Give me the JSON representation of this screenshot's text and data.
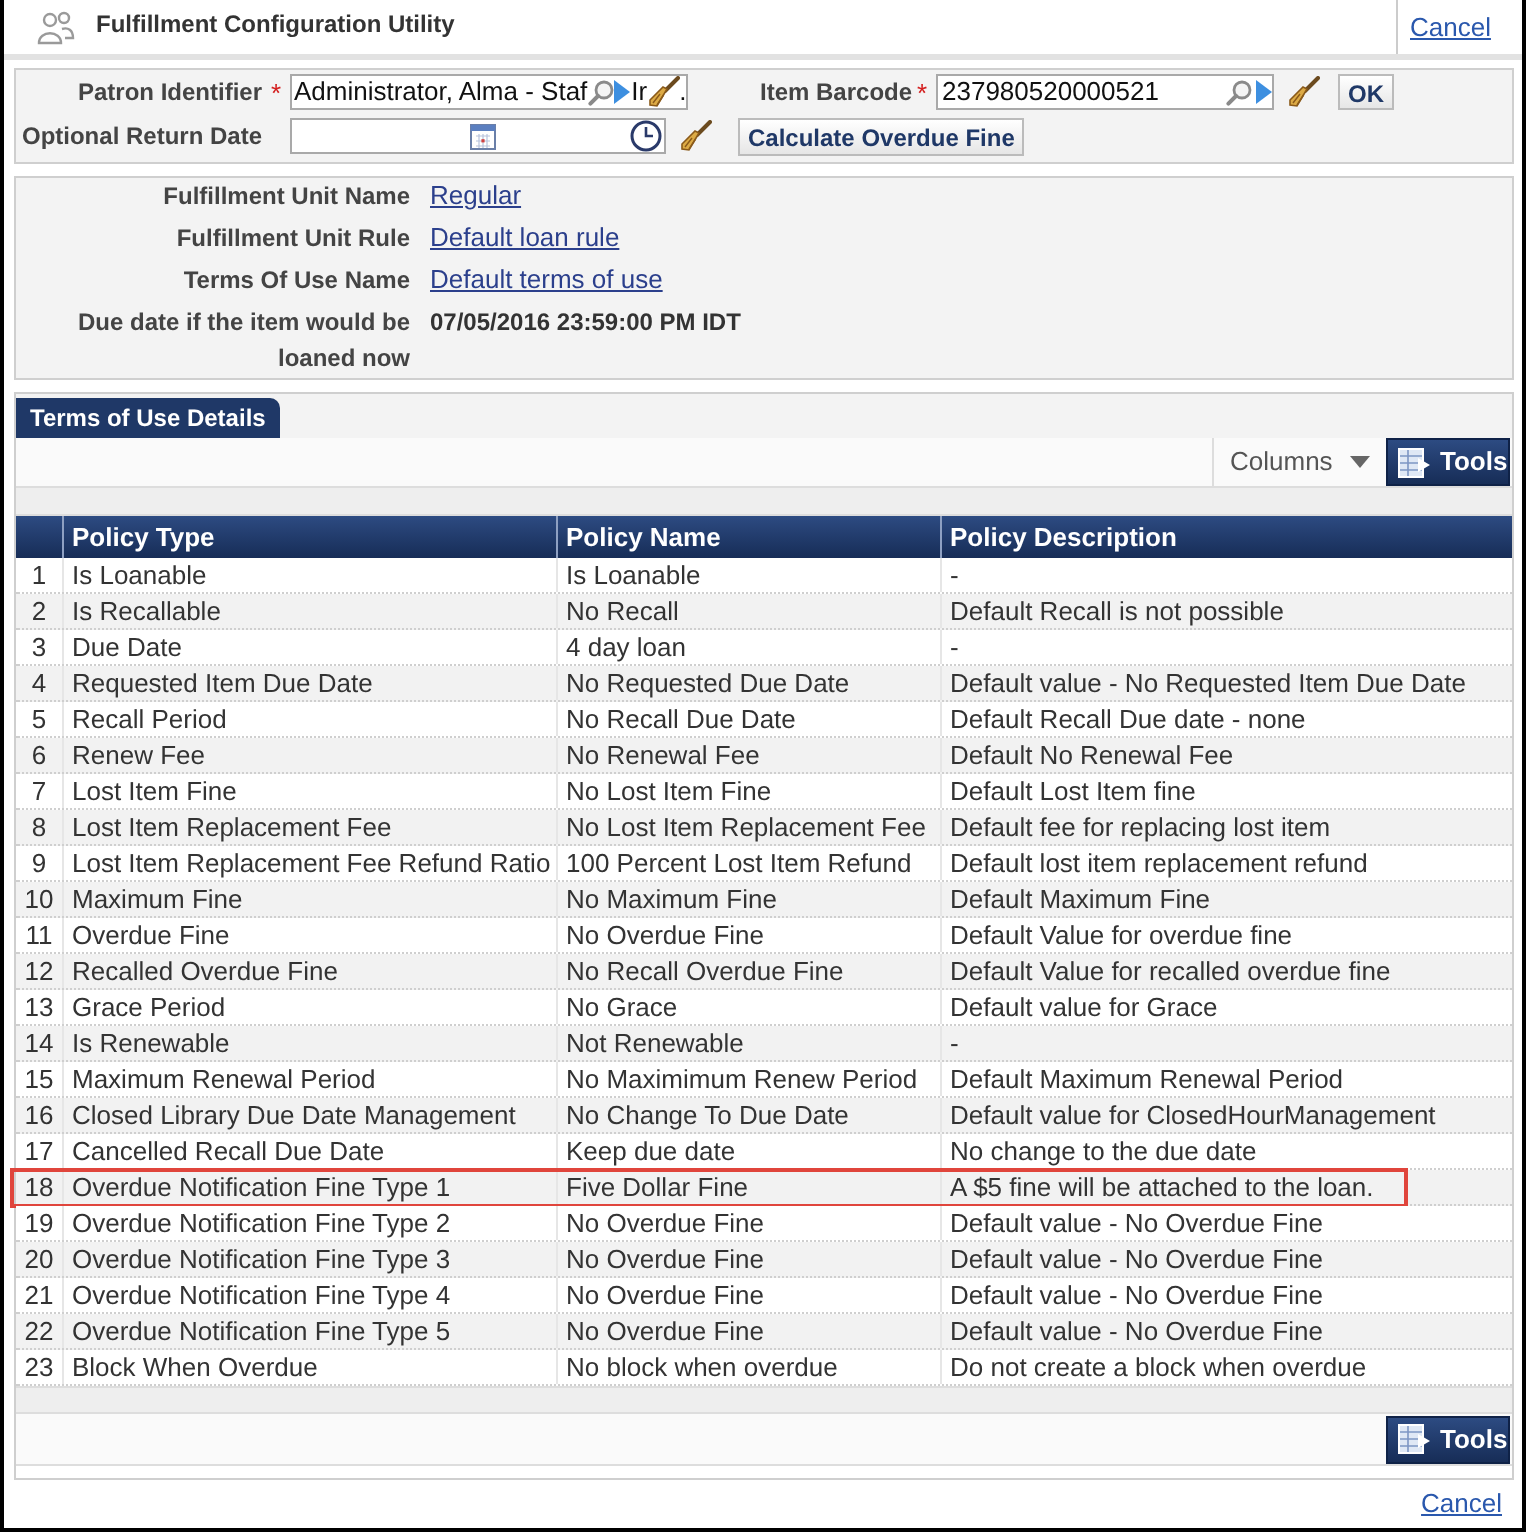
{
  "window": {
    "title": "Fulfillment Configuration Utility",
    "cancel_link": "Cancel"
  },
  "search_form": {
    "patron": {
      "label": "Patron Identifier",
      "required_mark": "*",
      "value": "Administrator, Alma - Staf",
      "cut_text": "Ir",
      "trailing_text": "."
    },
    "item_barcode": {
      "label": "Item Barcode",
      "required_mark": "*",
      "value": "237980520000521"
    },
    "ok_button": "OK",
    "return_date": {
      "label": "Optional Return Date"
    },
    "calculate_button": "Calculate Overdue Fine"
  },
  "details": [
    {
      "label": "Fulfillment Unit Name",
      "value": "Regular",
      "kind": "link"
    },
    {
      "label": "Fulfillment Unit Rule",
      "value": "Default loan rule",
      "kind": "link"
    },
    {
      "label": "Terms Of Use Name",
      "value": "Default terms of use",
      "kind": "link"
    },
    {
      "label": "Due date if the item would be loaned now",
      "value": "07/05/2016 23:59:00 PM IDT",
      "kind": "text"
    }
  ],
  "tabs": [
    {
      "label": "Terms of Use Details",
      "selected": true
    }
  ],
  "toolbar": {
    "columns_dropdown": "Columns",
    "tools_button": "Tools"
  },
  "table": {
    "columns": [
      "Policy Type",
      "Policy Name",
      "Policy Description"
    ],
    "rows": [
      {
        "number": "1",
        "cells": [
          "Is Loanable",
          "Is Loanable",
          "-"
        ],
        "highlighted": false
      },
      {
        "number": "2",
        "cells": [
          "Is Recallable",
          "No Recall",
          "Default Recall is not possible"
        ],
        "highlighted": false
      },
      {
        "number": "3",
        "cells": [
          "Due Date",
          "4 day loan",
          "-"
        ],
        "highlighted": false
      },
      {
        "number": "4",
        "cells": [
          "Requested Item Due Date",
          "No Requested Due Date",
          "Default value - No Requested Item Due Date"
        ],
        "highlighted": false
      },
      {
        "number": "5",
        "cells": [
          "Recall Period",
          "No Recall Due Date",
          "Default Recall Due date - none"
        ],
        "highlighted": false
      },
      {
        "number": "6",
        "cells": [
          "Renew Fee",
          "No Renewal Fee",
          "Default No Renewal Fee"
        ],
        "highlighted": false
      },
      {
        "number": "7",
        "cells": [
          "Lost Item Fine",
          "No Lost Item Fine",
          "Default Lost Item fine"
        ],
        "highlighted": false
      },
      {
        "number": "8",
        "cells": [
          "Lost Item Replacement Fee",
          "No Lost Item Replacement Fee",
          "Default fee for replacing lost item"
        ],
        "highlighted": false
      },
      {
        "number": "9",
        "cells": [
          "Lost Item Replacement Fee Refund Ratio",
          "100 Percent Lost Item Refund",
          "Default lost item replacement refund"
        ],
        "highlighted": false
      },
      {
        "number": "10",
        "cells": [
          "Maximum Fine",
          "No Maximum Fine",
          "Default Maximum Fine"
        ],
        "highlighted": false
      },
      {
        "number": "11",
        "cells": [
          "Overdue Fine",
          "No Overdue Fine",
          "Default Value for overdue fine"
        ],
        "highlighted": false
      },
      {
        "number": "12",
        "cells": [
          "Recalled Overdue Fine",
          "No Recall Overdue Fine",
          "Default Value for recalled overdue fine"
        ],
        "highlighted": false
      },
      {
        "number": "13",
        "cells": [
          "Grace Period",
          "No Grace",
          "Default value for Grace"
        ],
        "highlighted": false
      },
      {
        "number": "14",
        "cells": [
          "Is Renewable",
          "Not Renewable",
          "-"
        ],
        "highlighted": false
      },
      {
        "number": "15",
        "cells": [
          "Maximum Renewal Period",
          "No Maximimum Renew Period",
          "Default Maximum Renewal Period"
        ],
        "highlighted": false
      },
      {
        "number": "16",
        "cells": [
          "Closed Library Due Date Management",
          "No Change To Due Date",
          "Default value for ClosedHourManagement"
        ],
        "highlighted": false
      },
      {
        "number": "17",
        "cells": [
          "Cancelled Recall Due Date",
          "Keep due date",
          "No change to the due date"
        ],
        "highlighted": false
      },
      {
        "number": "18",
        "cells": [
          "Overdue Notification Fine Type 1",
          "Five Dollar Fine",
          "A $5 fine will be attached to the loan."
        ],
        "highlighted": true
      },
      {
        "number": "19",
        "cells": [
          "Overdue Notification Fine Type 2",
          "No Overdue Fine",
          "Default value - No Overdue Fine"
        ],
        "highlighted": false
      },
      {
        "number": "20",
        "cells": [
          "Overdue Notification Fine Type 3",
          "No Overdue Fine",
          "Default value - No Overdue Fine"
        ],
        "highlighted": false
      },
      {
        "number": "21",
        "cells": [
          "Overdue Notification Fine Type 4",
          "No Overdue Fine",
          "Default value - No Overdue Fine"
        ],
        "highlighted": false
      },
      {
        "number": "22",
        "cells": [
          "Overdue Notification Fine Type 5",
          "No Overdue Fine",
          "Default value - No Overdue Fine"
        ],
        "highlighted": false
      },
      {
        "number": "23",
        "cells": [
          "Block When Overdue",
          "No block when overdue",
          "Do not create a block when overdue"
        ],
        "highlighted": false
      }
    ]
  },
  "footer_toolbar": {
    "tools_button": "Tools"
  },
  "footer": {
    "cancel_link": "Cancel"
  }
}
